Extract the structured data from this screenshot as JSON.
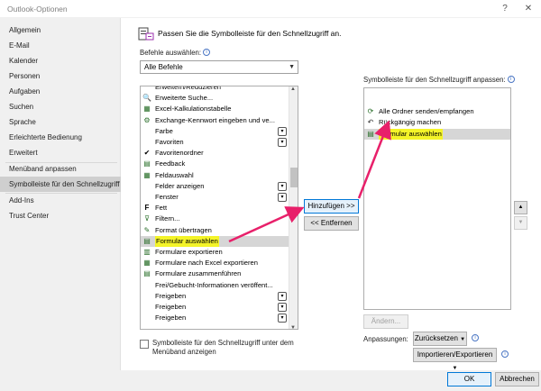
{
  "window": {
    "title": "Outlook-Optionen",
    "help": "?",
    "close": "✕"
  },
  "sidebar": {
    "items": [
      {
        "label": "Allgemein"
      },
      {
        "label": "E-Mail"
      },
      {
        "label": "Kalender"
      },
      {
        "label": "Personen"
      },
      {
        "label": "Aufgaben"
      },
      {
        "label": "Suchen"
      },
      {
        "label": "Sprache"
      },
      {
        "label": "Erleichterte Bedienung"
      },
      {
        "label": "Erweitert"
      },
      {
        "label": "Menüband anpassen"
      },
      {
        "label": "Symbolleiste für den Schnellzugriff",
        "selected": true
      },
      {
        "label": "Add-Ins"
      },
      {
        "label": "Trust Center"
      }
    ]
  },
  "main": {
    "heading": "Passen Sie die Symbolleiste für den Schnellzugriff an.",
    "commands_label": "Befehle auswählen:",
    "commands_select": "Alle Befehle",
    "toolbar_label": "Symbolleiste für den Schnellzugriff anpassen:",
    "commands": [
      {
        "icon": "",
        "label": "Erweitern/Reduzieren",
        "dropdown": false
      },
      {
        "icon": "search-icon",
        "label": "Erweiterte Suche...",
        "dropdown": false
      },
      {
        "icon": "excel-icon",
        "label": "Excel-Kalkulationstabelle",
        "dropdown": false
      },
      {
        "icon": "exchange-icon",
        "label": "Exchange-Kennwort eingeben und ve...",
        "dropdown": false
      },
      {
        "icon": "",
        "label": "Farbe",
        "dropdown": true
      },
      {
        "icon": "",
        "label": "Favoriten",
        "dropdown": true
      },
      {
        "icon": "check-icon",
        "label": "Favoritenordner",
        "dropdown": false
      },
      {
        "icon": "feedback-icon",
        "label": "Feedback",
        "dropdown": false
      },
      {
        "icon": "field-icon",
        "label": "Feldauswahl",
        "dropdown": false
      },
      {
        "icon": "",
        "label": "Felder anzeigen",
        "dropdown": true
      },
      {
        "icon": "",
        "label": "Fenster",
        "dropdown": true
      },
      {
        "icon": "bold-icon",
        "label": "Fett",
        "dropdown": false
      },
      {
        "icon": "filter-icon",
        "label": "Filtern...",
        "dropdown": false
      },
      {
        "icon": "brush-icon",
        "label": "Format übertragen",
        "dropdown": false
      },
      {
        "icon": "form-icon",
        "label": "Formular auswählen",
        "dropdown": false,
        "selected": true,
        "highlight": true
      },
      {
        "icon": "export-icon",
        "label": "Formulare exportieren",
        "dropdown": false
      },
      {
        "icon": "excel-export-icon",
        "label": "Formulare nach Excel exportieren",
        "dropdown": false
      },
      {
        "icon": "merge-icon",
        "label": "Formulare zusammenführen",
        "dropdown": false
      },
      {
        "icon": "",
        "label": "Frei/Gebucht-Informationen veröffent...",
        "dropdown": false
      },
      {
        "icon": "",
        "label": "Freigeben",
        "dropdown": true
      },
      {
        "icon": "",
        "label": "Freigeben",
        "dropdown": true
      },
      {
        "icon": "",
        "label": "Freigeben",
        "dropdown": true
      }
    ],
    "toolbar_items": [
      {
        "icon": "sync-icon",
        "label": "Alle Ordner senden/empfangen"
      },
      {
        "icon": "undo-icon",
        "label": "Rückgängig machen"
      },
      {
        "icon": "form-icon",
        "label": "Formular auswählen",
        "selected": true,
        "highlight": true
      }
    ],
    "add_button": "Hinzufügen >>",
    "remove_button": "<< Entfernen",
    "modify_button": "Ändern...",
    "customizations_label": "Anpassungen:",
    "reset_button": "Zurücksetzen",
    "import_export_button": "Importieren/Exportieren",
    "below_ribbon_checkbox": "Symbolleiste für den Schnellzugriff unter dem Menüband anzeigen",
    "below_ribbon_line1": "Symbolleiste für den Schnellzugriff unter dem",
    "below_ribbon_line2": "Menüband anzeigen",
    "ok_button": "OK",
    "cancel_button": "Abbrechen"
  },
  "colors": {
    "highlight": "#f4f428",
    "arrow": "#e8206a",
    "selected_nav": "#cfcfcf",
    "accent": "#0078d7"
  }
}
